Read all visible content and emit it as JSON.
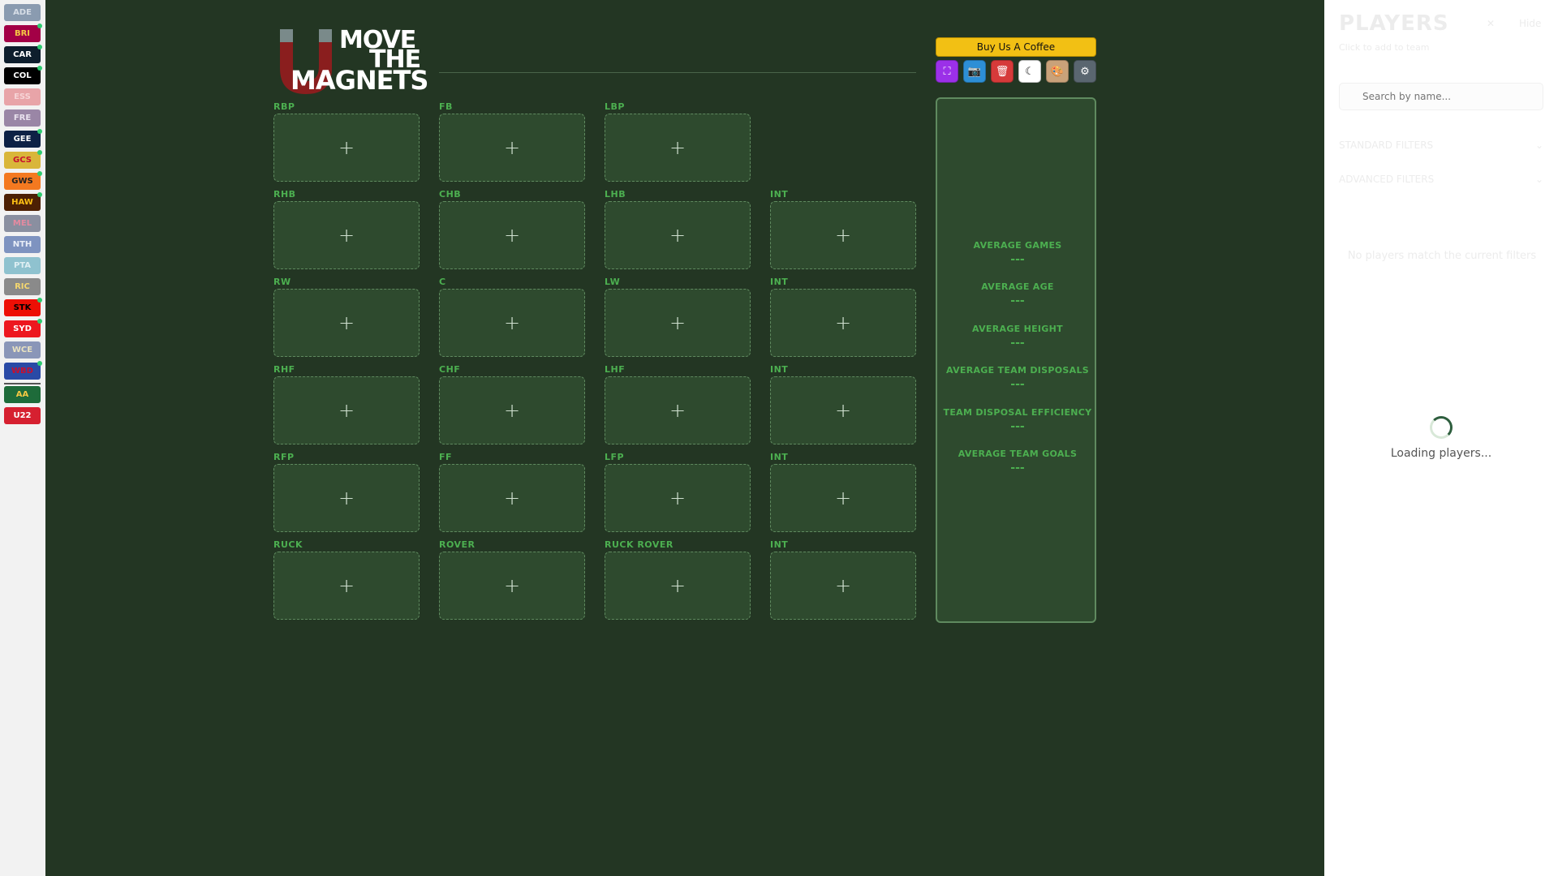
{
  "colors": {
    "background": "#233623",
    "accent": "#4caf50",
    "coffee": "#f2c014"
  },
  "teams": [
    {
      "code": "ADE",
      "bg": "#8a9bb0",
      "fg": "#d6dde6",
      "dot": false
    },
    {
      "code": "BRI",
      "bg": "#a30046",
      "fg": "#f4c843",
      "dot": true
    },
    {
      "code": "CAR",
      "bg": "#0e1e2d",
      "fg": "#ffffff",
      "dot": true
    },
    {
      "code": "COL",
      "bg": "#000000",
      "fg": "#ffffff",
      "dot": true
    },
    {
      "code": "ESS",
      "bg": "#e8a4a8",
      "fg": "#f6d4d6",
      "dot": false
    },
    {
      "code": "FRE",
      "bg": "#9a86a6",
      "fg": "#e9e2ee",
      "dot": false
    },
    {
      "code": "GEE",
      "bg": "#0d2145",
      "fg": "#ffffff",
      "dot": true
    },
    {
      "code": "GCS",
      "bg": "#d9b63a",
      "fg": "#c8102e",
      "dot": true
    },
    {
      "code": "GWS",
      "bg": "#f47920",
      "fg": "#222222",
      "dot": true
    },
    {
      "code": "HAW",
      "bg": "#4d2004",
      "fg": "#fbbf15",
      "dot": true
    },
    {
      "code": "MEL",
      "bg": "#8a8fa0",
      "fg": "#e58aa0",
      "dot": false
    },
    {
      "code": "NTH",
      "bg": "#7e93c0",
      "fg": "#e9eef7",
      "dot": false
    },
    {
      "code": "PTA",
      "bg": "#8fc2cf",
      "fg": "#dfeff3",
      "dot": false
    },
    {
      "code": "RIC",
      "bg": "#8a8a8a",
      "fg": "#f5d76e",
      "dot": false
    },
    {
      "code": "STK",
      "bg": "#ed0f05",
      "fg": "#000000",
      "dot": true
    },
    {
      "code": "SYD",
      "bg": "#ed171f",
      "fg": "#ffffff",
      "dot": true
    },
    {
      "code": "WCE",
      "bg": "#8a96b8",
      "fg": "#e9e2c0",
      "dot": false
    },
    {
      "code": "WBD",
      "bg": "#2a4aa6",
      "fg": "#c8102e",
      "dot": true
    },
    {
      "code": "AA",
      "bg": "#1e6b3a",
      "fg": "#f4c843",
      "dot": false
    },
    {
      "code": "U22",
      "bg": "#d62030",
      "fg": "#ffffff",
      "dot": false
    }
  ],
  "logo": {
    "line1": "MOVE",
    "line2": "THE",
    "line3": "MAGNETS"
  },
  "slot_symbol": "+",
  "field": {
    "rows": [
      [
        "RBP",
        "FB",
        "LBP"
      ],
      [
        "RHB",
        "CHB",
        "LHB",
        "INT"
      ],
      [
        "RW",
        "C",
        "LW",
        "INT"
      ],
      [
        "RHF",
        "CHF",
        "LHF",
        "INT"
      ],
      [
        "RFP",
        "FF",
        "LFP",
        "INT"
      ],
      [
        "RUCK",
        "ROVER",
        "RUCK ROVER",
        "INT"
      ]
    ]
  },
  "controls": {
    "coffee_label": "Buy Us A Coffee",
    "tools": [
      {
        "name": "fullscreen-icon",
        "bg": "#9b30e8",
        "glyph": "⛶",
        "fg": "#ffffff"
      },
      {
        "name": "camera-icon",
        "bg": "#2d8fd6",
        "glyph": "📷",
        "fg": "#ffffff"
      },
      {
        "name": "trash-icon",
        "bg": "#d63a3a",
        "glyph": "🗑",
        "fg": "#ffffff"
      },
      {
        "name": "moon-icon",
        "bg": "#ffffff",
        "glyph": "☾",
        "fg": "#111111"
      },
      {
        "name": "palette-icon",
        "bg": "#c9a27a",
        "glyph": "🎨",
        "fg": "#222222"
      },
      {
        "name": "gear-icon",
        "bg": "#5a6670",
        "glyph": "⚙",
        "fg": "#ffffff"
      }
    ]
  },
  "stats": [
    {
      "label": "AVERAGE GAMES",
      "value": "---"
    },
    {
      "label": "AVERAGE AGE",
      "value": "---"
    },
    {
      "label": "AVERAGE HEIGHT",
      "value": "---"
    },
    {
      "label": "AVERAGE TEAM DISPOSALS",
      "value": "---"
    },
    {
      "label": "TEAM DISPOSAL EFFICIENCY",
      "value": "---"
    },
    {
      "label": "AVERAGE TEAM GOALS",
      "value": "---"
    }
  ],
  "players": {
    "title": "PLAYERS",
    "subtitle": "Click to add to team",
    "close_label": "✕",
    "hide_label": "Hide",
    "search_placeholder": "Search by name...",
    "filter1": "STANDARD FILTERS",
    "filter2": "ADVANCED FILTERS",
    "empty_note": "No players match the current filters",
    "loading": "Loading players..."
  }
}
